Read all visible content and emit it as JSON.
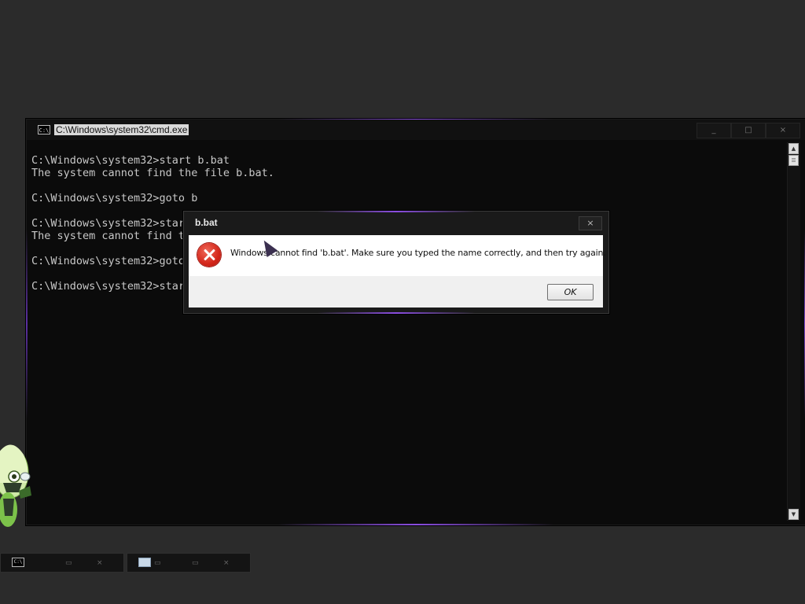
{
  "cmd_window": {
    "title": "C:\\Windows\\system32\\cmd.exe",
    "icon_label": "C:\\",
    "controls": {
      "minimize": "_",
      "maximize": "□",
      "close": "×"
    },
    "console_lines": [
      "C:\\Windows\\system32>start b.bat",
      "The system cannot find the file b.bat.",
      "",
      "C:\\Windows\\system32>goto b",
      "",
      "C:\\Windows\\system32>star",
      "The system cannot find t",
      "",
      "C:\\Windows\\system32>goto",
      "",
      "C:\\Windows\\system32>star"
    ]
  },
  "dialog": {
    "title": "b.bat",
    "close_label": "×",
    "message": "Windows cannot find 'b.bat'. Make sure you typed the name correctly, and then try again.",
    "icon": "error-icon",
    "ok_label": "OK"
  },
  "taskbar": {
    "items": [
      {
        "icon": "cmd-icon",
        "icon_label": "C:\\",
        "controls": [
          "▭",
          "×"
        ]
      },
      {
        "icon": "monitor-icon",
        "icon_label": "",
        "controls": [
          "▭",
          "▭",
          "×"
        ]
      }
    ]
  },
  "colors": {
    "accent_glow": "#8a4de0",
    "console_text": "#c8c8c8",
    "error_red": "#d3261a"
  }
}
